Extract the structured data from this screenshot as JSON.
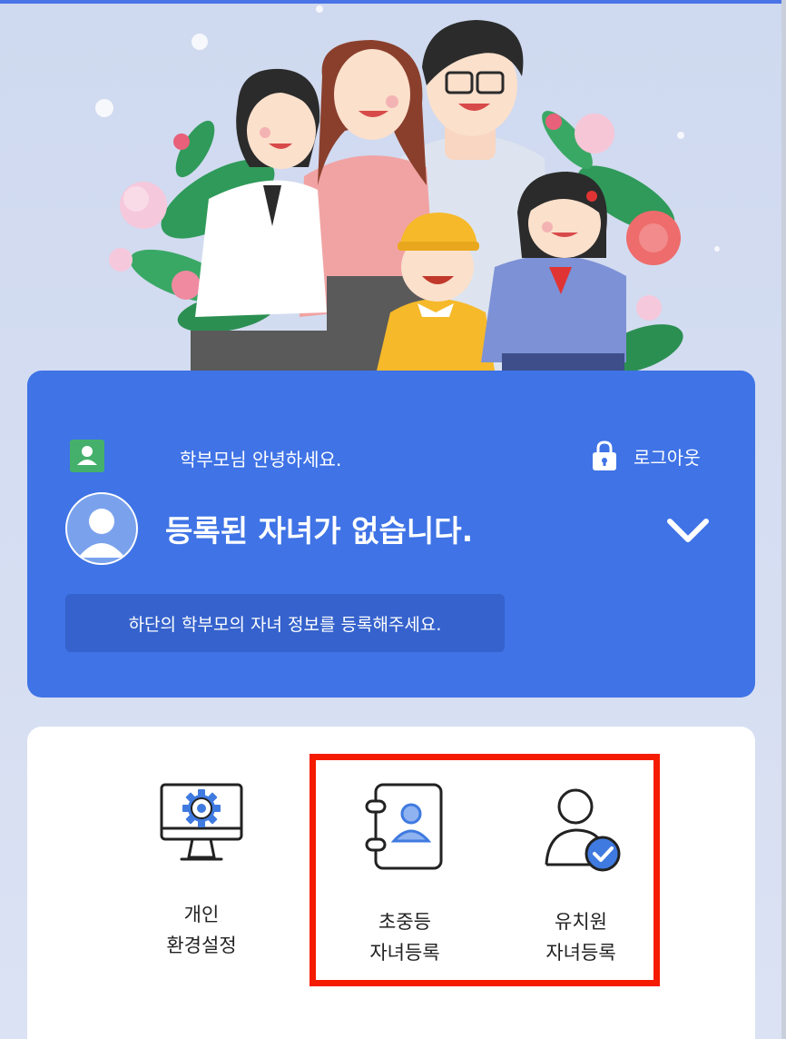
{
  "header": {
    "greeting": "학부모님 안녕하세요.",
    "logout_label": "로그아웃",
    "status_title": "등록된 자녀가 없습니다.",
    "info_message": "하단의 학부모의 자녀 정보를 등록해주세요."
  },
  "menu": {
    "items": [
      {
        "label_line1": "개인",
        "label_line2": "환경설정",
        "icon": "monitor-gear-icon"
      },
      {
        "label_line1": "초중등",
        "label_line2": "자녀등록",
        "icon": "address-book-icon"
      },
      {
        "label_line1": "유치원",
        "label_line2": "자녀등록",
        "icon": "user-check-icon"
      }
    ]
  },
  "colors": {
    "card_blue": "#3f73e6",
    "pill_blue": "#3562cc",
    "badge_green": "#45b06b",
    "highlight_red": "#f51b00",
    "icon_blue": "#3f7ae0"
  }
}
